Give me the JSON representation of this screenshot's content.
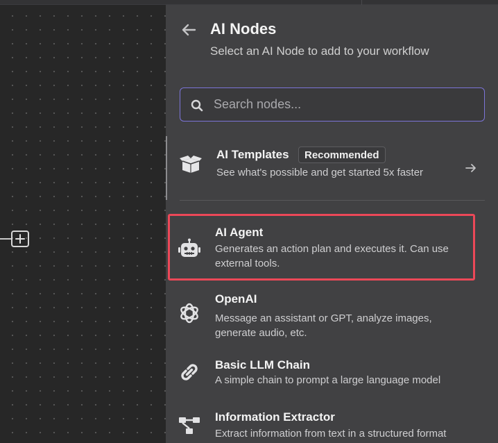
{
  "panel": {
    "title": "AI Nodes",
    "subtitle": "Select an AI Node to add to your workflow"
  },
  "search": {
    "placeholder": "Search nodes...",
    "value": ""
  },
  "templates": {
    "title": "AI Templates",
    "badge": "Recommended",
    "description": "See what's possible and get started 5x faster",
    "icon": "open-box-icon"
  },
  "nodes": [
    {
      "title": "AI Agent",
      "description": "Generates an action plan and executes it. Can use external tools.",
      "icon": "robot-icon",
      "highlighted": true
    },
    {
      "title": "OpenAI",
      "description": "Message an assistant or GPT, analyze images, generate audio, etc.",
      "icon": "openai-logo-icon"
    },
    {
      "title": "Basic LLM Chain",
      "description": "A simple chain to prompt a large language model",
      "icon": "link-icon"
    },
    {
      "title": "Information Extractor",
      "description": "Extract information from text in a structured format",
      "icon": "tree-structure-icon"
    }
  ],
  "colors": {
    "panel_bg": "#414143",
    "canvas_bg": "#272727",
    "search_border": "#7c75d9",
    "highlight": "#ec4858"
  }
}
